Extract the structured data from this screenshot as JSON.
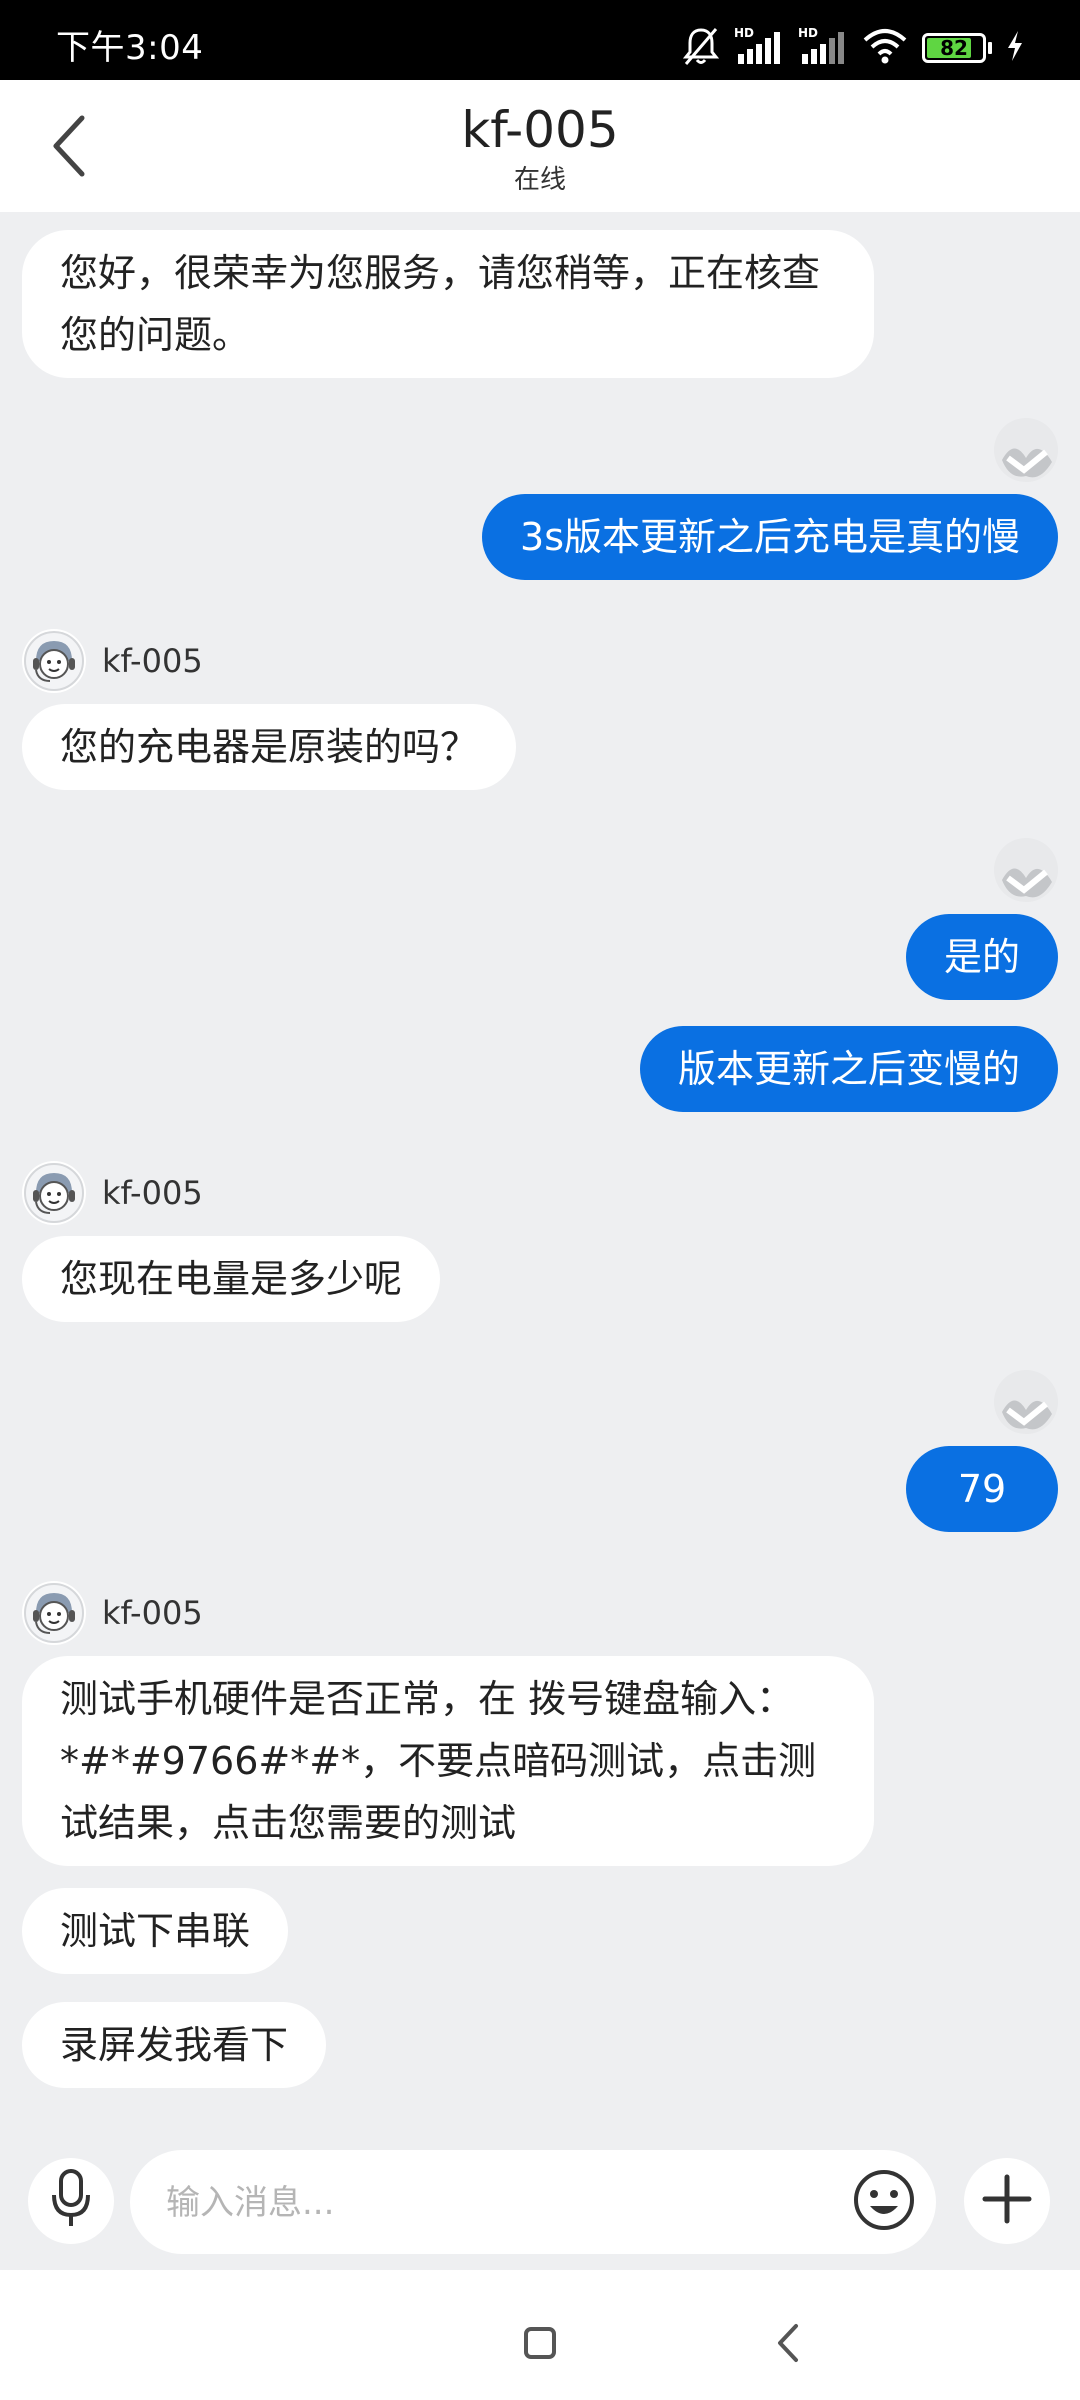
{
  "status_bar": {
    "time": "下午3:04",
    "battery": "82",
    "battery_level": 0.82,
    "icons": [
      "mute-bell-icon",
      "hd-signal-icon",
      "hd-signal-icon",
      "wifi-icon",
      "battery-icon",
      "charging-icon"
    ]
  },
  "header": {
    "title": "kf-005",
    "subtitle": "在线"
  },
  "messages": [
    {
      "from": "agent",
      "text": "您好，很荣幸为您服务，请您稍等，正在核查您的问题。"
    },
    {
      "from": "user",
      "text": "3s版本更新之后充电是真的慢"
    },
    {
      "from": "agent",
      "name": "kf-005",
      "text": "您的充电器是原装的吗？"
    },
    {
      "from": "user",
      "text": "是的"
    },
    {
      "from": "user",
      "text": "版本更新之后变慢的"
    },
    {
      "from": "agent",
      "name": "kf-005",
      "text": "您现在电量是多少呢"
    },
    {
      "from": "user",
      "text": "79"
    },
    {
      "from": "agent",
      "name": "kf-005",
      "text": "测试手机硬件是否正常，在 拨号键盘输入：*#*#9766#*#*，不要点暗码测试，点击测试结果，点击您需要的测试"
    },
    {
      "from": "agent",
      "text": "测试下串联"
    },
    {
      "from": "agent",
      "text": "录屏发我看下"
    }
  ],
  "input": {
    "placeholder": "输入消息..."
  },
  "colors": {
    "accent": "#0a70e2",
    "background": "#eeeff1",
    "agent_bubble": "#ffffff"
  }
}
